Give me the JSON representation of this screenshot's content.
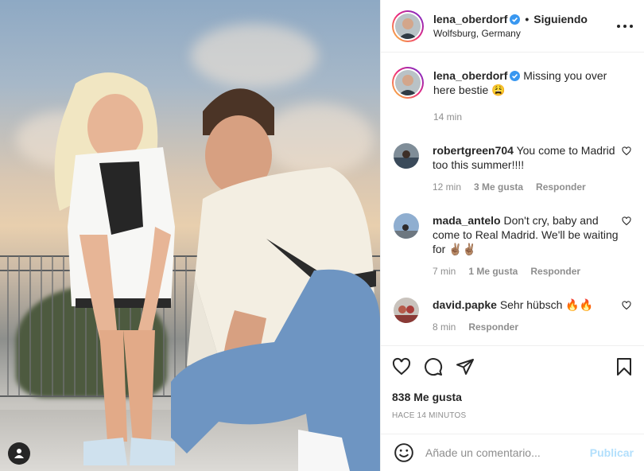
{
  "post": {
    "author": "lena_oberdorf",
    "follow_status": "Siguiendo",
    "location": "Wolfsburg, Germany",
    "caption": "Missing you over here bestie 😩",
    "caption_time": "14 min",
    "likes": "838 Me gusta",
    "time_ago": "HACE 14 MINUTOS"
  },
  "comments": [
    {
      "user": "robertgreen704",
      "text": "You come to Madrid too this summer!!!!",
      "time": "12 min",
      "likes": "3 Me gusta",
      "reply": "Responder"
    },
    {
      "user": "mada_antelo",
      "text": "Don't cry, baby and come to Real Madrid. We'll be waiting for ✌🏽✌🏽",
      "time": "7 min",
      "likes": "1 Me gusta",
      "reply": "Responder"
    },
    {
      "user": "david.papke",
      "text": "Sehr hübsch 🔥🔥",
      "time": "8 min",
      "likes": "",
      "reply": "Responder"
    }
  ],
  "add_comment": {
    "placeholder": "Añade un comentario...",
    "post_label": "Publicar"
  },
  "icons": {
    "like": "heart-icon",
    "comment": "comment-icon",
    "share": "share-icon",
    "save": "bookmark-icon",
    "emoji": "emoji-icon",
    "more": "more-options-icon",
    "user_tag": "user-tag-icon"
  },
  "colors": {
    "verified": "#3897f0",
    "post_button_disabled": "#b2dffc",
    "secondary_text": "#8e8e8e"
  }
}
